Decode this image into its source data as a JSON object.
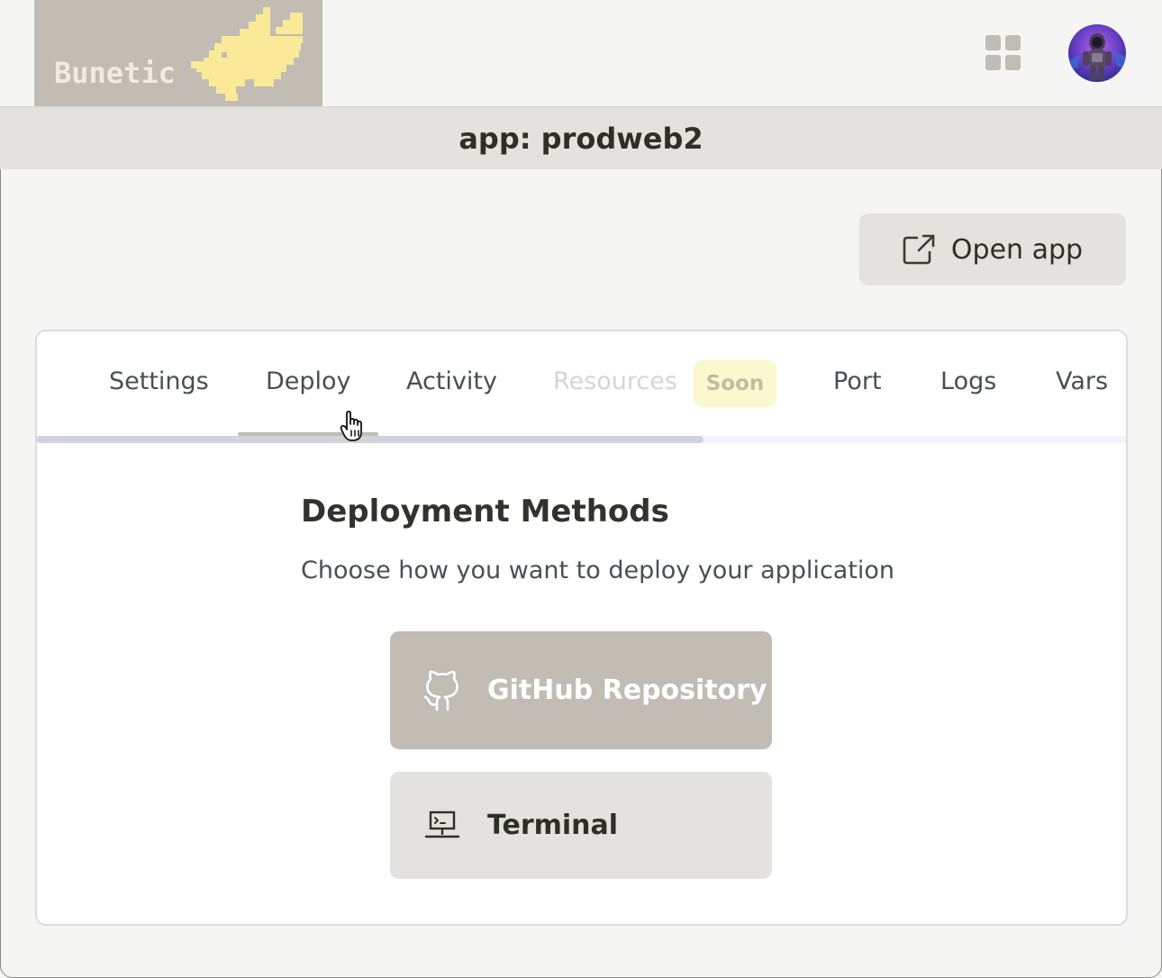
{
  "header": {
    "logo_text": "Bunetic",
    "apps_icon": "grid-icon",
    "avatar_icon": "astronaut-avatar"
  },
  "app": {
    "title": "app: prodweb2"
  },
  "actions": {
    "open_app_label": "Open app",
    "open_app_icon": "external-link-icon"
  },
  "tabs": [
    {
      "label": "Settings"
    },
    {
      "label": "Deploy",
      "active": true
    },
    {
      "label": "Activity"
    },
    {
      "label": "Resources",
      "disabled": true,
      "badge": "Soon"
    },
    {
      "label": "Port"
    },
    {
      "label": "Logs"
    },
    {
      "label": "Vars"
    }
  ],
  "deploy": {
    "title": "Deployment Methods",
    "description": "Choose how you want to deploy your application",
    "methods": [
      {
        "label": "GitHub Repository",
        "icon": "github-icon"
      },
      {
        "label": "Terminal",
        "icon": "terminal-icon"
      }
    ]
  },
  "colors": {
    "accent": "#c1bcb4",
    "logo_bunny": "#faea98",
    "soon_badge_bg": "#fbf7cf",
    "title_bar_bg": "#e3e2de",
    "page_bg": "#f5f5f3"
  }
}
